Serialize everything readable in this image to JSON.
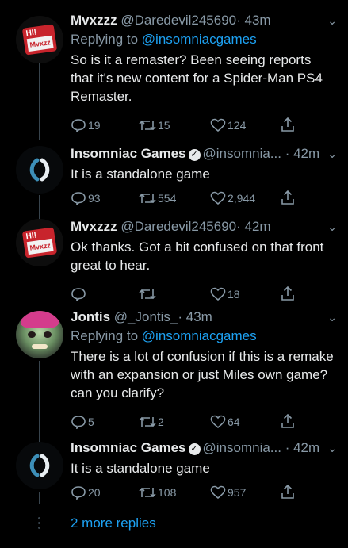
{
  "tweets": [
    {
      "name": "Mvxzzz",
      "handle": "@Daredevil245690",
      "time": "· 43m",
      "replying_prefix": "Replying to ",
      "replying_to": "@insomniacgames",
      "text": "So is it a remaster? Been seeing reports that it's new content for a Spider-Man PS4 Remaster.",
      "replies": "19",
      "retweets": "15",
      "likes": "124",
      "avatar_label_top": "HI!",
      "avatar_label_tag": "Mvxzz"
    },
    {
      "name": "Insomniac Games",
      "handle": "@insomnia...",
      "time": "· 42m",
      "text": "It is a standalone game",
      "replies": "93",
      "retweets": "554",
      "likes": "2,944"
    },
    {
      "name": "Mvxzzz",
      "handle": "@Daredevil245690",
      "time": "· 42m",
      "text": "Ok thanks. Got a bit confused on that front great to hear.",
      "replies": "",
      "retweets": "",
      "likes": "18",
      "avatar_label_top": "HI!",
      "avatar_label_tag": "Mvxzz"
    },
    {
      "name": "Jontis",
      "handle": "@_Jontis_",
      "time": "· 43m",
      "replying_prefix": "Replying to ",
      "replying_to": "@insomniacgames",
      "text": "There is a lot of confusion if this is a remake with an expansion or just Miles own game? can you clarify?",
      "replies": "5",
      "retweets": "2",
      "likes": "64"
    },
    {
      "name": "Insomniac Games",
      "handle": "@insomnia...",
      "time": "· 42m",
      "text": "It is a standalone game",
      "replies": "20",
      "retweets": "108",
      "likes": "957"
    }
  ],
  "more_replies": "2 more replies",
  "icons": {
    "reply": "reply-icon",
    "retweet": "retweet-icon",
    "like": "heart-icon",
    "share": "share-icon",
    "verified": "verified-badge-icon",
    "caret": "chevron-down-icon"
  },
  "colors": {
    "background": "#000000",
    "link": "#1da1f2",
    "secondary_text": "#8899a6",
    "primary_text": "#e7e9ea"
  }
}
